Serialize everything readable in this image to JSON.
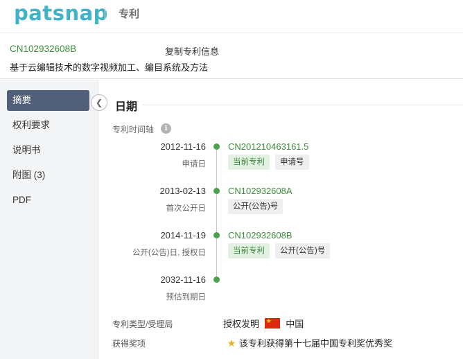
{
  "topbar": {
    "logo": "patsnap",
    "section": "专利"
  },
  "patent": {
    "number": "CN102932608B",
    "copy_label": "复制专利信息",
    "title": "基于云编辑技术的数字视频加工、编目系统及方法"
  },
  "sidebar": {
    "items": [
      {
        "label": "摘要",
        "active": true
      },
      {
        "label": "权利要求",
        "active": false
      },
      {
        "label": "说明书",
        "active": false
      },
      {
        "label": "附图 (3)",
        "active": false
      },
      {
        "label": "PDF",
        "active": false
      }
    ],
    "collapse_icon": "chevron-left-icon"
  },
  "dates": {
    "title": "日期",
    "timeline_label": "专利时间轴",
    "info_icon": "i",
    "events": [
      {
        "date": "2012-11-16",
        "caption": "申请日",
        "patent": "CN201210463161.5",
        "tags": [
          "当前专利",
          "申请号"
        ]
      },
      {
        "date": "2013-02-13",
        "caption": "首次公开日",
        "patent": "CN102932608A",
        "tags": [
          "公开(公告)号"
        ]
      },
      {
        "date": "2014-11-19",
        "caption": "公开(公告)日, 授权日",
        "patent": "CN102932608B",
        "tags": [
          "当前专利",
          "公开(公告)号"
        ]
      },
      {
        "date": "2032-11-16",
        "caption": "预估到期日",
        "patent": "",
        "tags": []
      }
    ]
  },
  "meta": {
    "type_label": "专利类型/受理局",
    "type_value": "授权发明",
    "country": "中国",
    "award_label": "获得奖项",
    "award_value": "该专利获得第十七届中国专利奖优秀奖"
  },
  "colors": {
    "accent_green": "#3a8e3a",
    "nav_active": "#525f78",
    "logo": "#3fb3c8"
  }
}
